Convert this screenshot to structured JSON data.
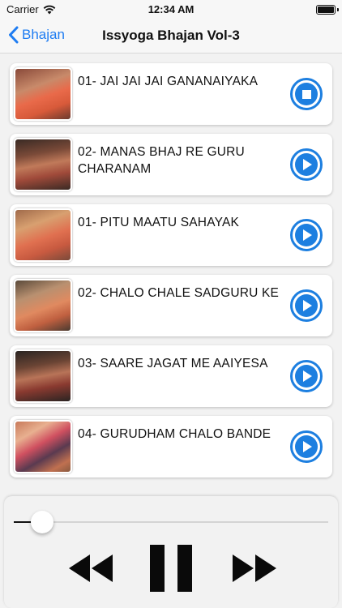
{
  "status": {
    "carrier": "Carrier",
    "time": "12:34 AM"
  },
  "nav": {
    "back_label": "Bhajan",
    "title": "Issyoga Bhajan Vol-3"
  },
  "tracks": [
    {
      "title": "01- JAI JAI JAI GANANAIYAKA",
      "state": "stop"
    },
    {
      "title": "02- MANAS BHAJ RE GURU CHARANAM",
      "state": "play"
    },
    {
      "title": "01- PITU MAATU SAHAYAK",
      "state": "play"
    },
    {
      "title": "02- CHALO CHALE SADGURU KE",
      "state": "play"
    },
    {
      "title": "03- SAARE JAGAT ME AAIYESA",
      "state": "play"
    },
    {
      "title": "04- GURUDHAM CHALO BANDE",
      "state": "play"
    }
  ],
  "player": {
    "progress": 0.09,
    "state": "playing"
  },
  "colors": {
    "accent": "#1d7fe0",
    "ios_blue": "#1e7cf2"
  },
  "icons": {
    "back": "chevron-left-icon",
    "play": "play-icon",
    "stop": "stop-icon",
    "rewind": "rewind-icon",
    "pause": "pause-icon",
    "forward": "fast-forward-icon"
  }
}
